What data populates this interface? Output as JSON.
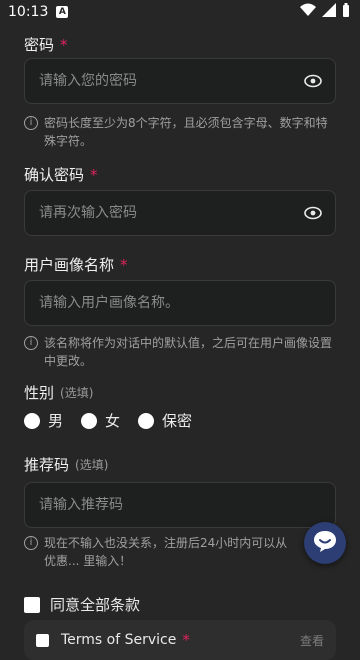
{
  "status": {
    "time": "10:13"
  },
  "password": {
    "label": "密码",
    "placeholder": "请输入您的密码",
    "hint": "密码长度至少为8个字符，且必须包含字母、数字和特殊字符。"
  },
  "confirm_password": {
    "label": "确认密码",
    "placeholder": "请再次输入密码"
  },
  "persona_name": {
    "label": "用户画像名称",
    "placeholder": "请输入用户画像名称。",
    "hint": "该名称将作为对话中的默认值，之后可在用户画像设置中更改。"
  },
  "gender": {
    "label": "性别",
    "optional": "(选填)",
    "options": [
      "男",
      "女",
      "保密"
    ]
  },
  "referral": {
    "label": "推荐码",
    "optional": "(选填)",
    "placeholder": "请输入推荐码",
    "hint": "现在不输入也没关系，注册后24小时内可以从优惠... 里输入！"
  },
  "agreement": {
    "all_label": "同意全部条款",
    "tos_label": "Terms of Service",
    "view_label": "查看"
  },
  "colors": {
    "required": "#e0245e",
    "fab": "#2c3e73"
  },
  "icons": [
    "eye-icon",
    "info-icon",
    "chat-icon"
  ]
}
